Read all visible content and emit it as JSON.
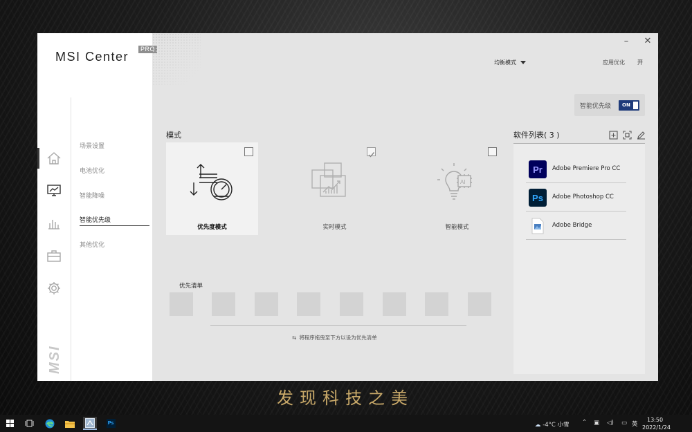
{
  "wallpaper": {
    "slogan": "发现科技之美"
  },
  "window": {
    "brand_title": "MSI Center",
    "brand_badge": "PRO",
    "controls": {
      "minimize": "–",
      "close": "✕"
    },
    "mode_select": "均衡模式",
    "app_opt_label": "应用优化",
    "app_opt_value": "开"
  },
  "rail": {
    "icons": [
      "home-icon",
      "monitor-icon",
      "bar-chart-icon",
      "toolbox-icon",
      "gear-icon"
    ],
    "active_index": 1,
    "logo": "MSI"
  },
  "sub_nav": {
    "items": [
      {
        "label": "场景设置"
      },
      {
        "label": "电池优化"
      },
      {
        "label": "智能降噪"
      },
      {
        "label": "智能优先级"
      },
      {
        "label": "其他优化"
      }
    ],
    "active_index": 3
  },
  "smart_priority": {
    "label": "智能优先级",
    "toggle_text": "ON",
    "on": true
  },
  "modes": {
    "title": "模式",
    "items": [
      {
        "label": "优先度模式",
        "selected": true,
        "checked": false,
        "icon": "priority-gauge-icon"
      },
      {
        "label": "实时模式",
        "selected": false,
        "checked": true,
        "icon": "realtime-chart-icon"
      },
      {
        "label": "智能模式",
        "selected": false,
        "checked": false,
        "icon": "ai-bulb-icon"
      }
    ]
  },
  "priority_list": {
    "title": "优先清单",
    "slot_count": 8,
    "hint": "将程序拖曳至下方以设为优先清单"
  },
  "software": {
    "title": "软件列表( 3 )",
    "actions": [
      "add-icon",
      "scan-icon",
      "edit-icon"
    ],
    "items": [
      {
        "name": "Adobe Premiere Pro CC",
        "icon_text": "Pr",
        "bg": "#00005b",
        "fg": "#9999ff"
      },
      {
        "name": "Adobe Photoshop CC",
        "icon_text": "Ps",
        "bg": "#001e36",
        "fg": "#31a8ff"
      },
      {
        "name": "Adobe Bridge",
        "icon_text": "",
        "bg": "#ffffff",
        "fg": "#4a7fc0"
      }
    ]
  },
  "taskbar": {
    "weather": "-4°C 小雪",
    "ime": "英",
    "time": "13:50",
    "date": "2022/1/24",
    "apps": [
      "windows-start-icon",
      "task-view-icon",
      "edge-icon",
      "file-explorer-icon",
      "msi-center-icon",
      "photoshop-icon"
    ]
  }
}
